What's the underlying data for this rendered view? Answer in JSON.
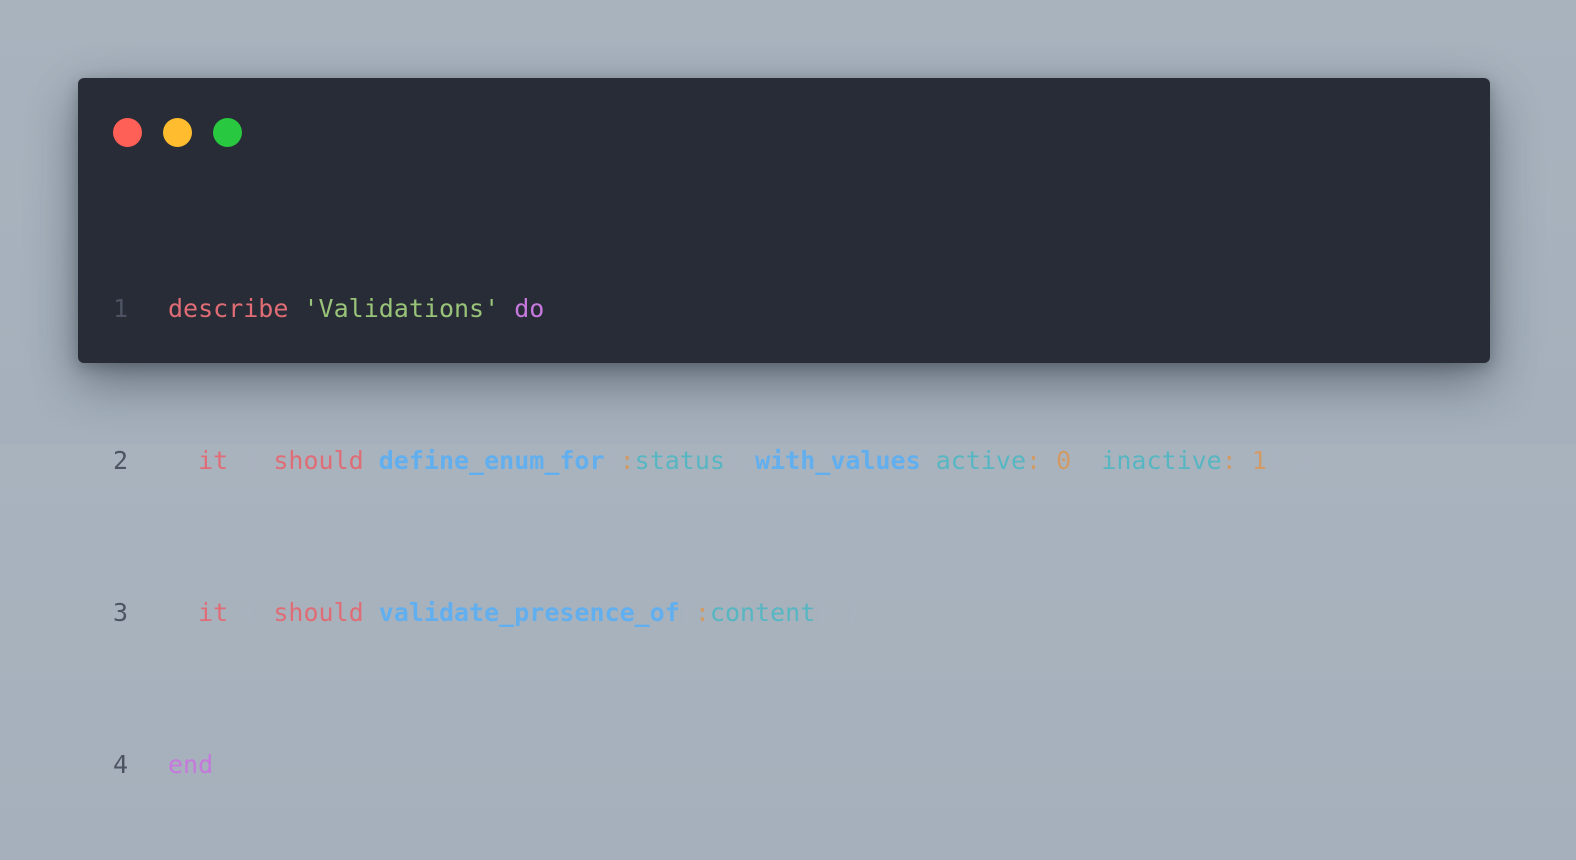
{
  "window": {
    "controls": {
      "close_color": "#fe5f57",
      "minimize_color": "#febc2e",
      "zoom_color": "#28c840"
    }
  },
  "code": {
    "lines": [
      {
        "number": "1",
        "tokens": {
          "t1": "describe",
          "t2": " ",
          "t3": "'Validations'",
          "t4": " ",
          "t5": "do"
        }
      },
      {
        "number": "2",
        "tokens": {
          "t1": "  ",
          "t2": "it",
          "t3": " { ",
          "t4": "should",
          "t5": " ",
          "t6": "define_enum_for",
          "t7": "(",
          "t8": ":",
          "t9": "status",
          "t10": ").",
          "t11": "with_values",
          "t12": "(",
          "t13": "active",
          "t14": ":",
          "t15": " ",
          "t16": "0",
          "t17": ", ",
          "t18": "inactive",
          "t19": ":",
          "t20": " ",
          "t21": "1",
          "t22": ") }"
        }
      },
      {
        "number": "3",
        "tokens": {
          "t1": "  ",
          "t2": "it",
          "t3": " { ",
          "t4": "should",
          "t5": " ",
          "t6": "validate_presence_of",
          "t7": "(",
          "t8": ":",
          "t9": "content",
          "t10": ") }"
        }
      },
      {
        "number": "4",
        "tokens": {
          "t1": "end"
        }
      }
    ]
  }
}
